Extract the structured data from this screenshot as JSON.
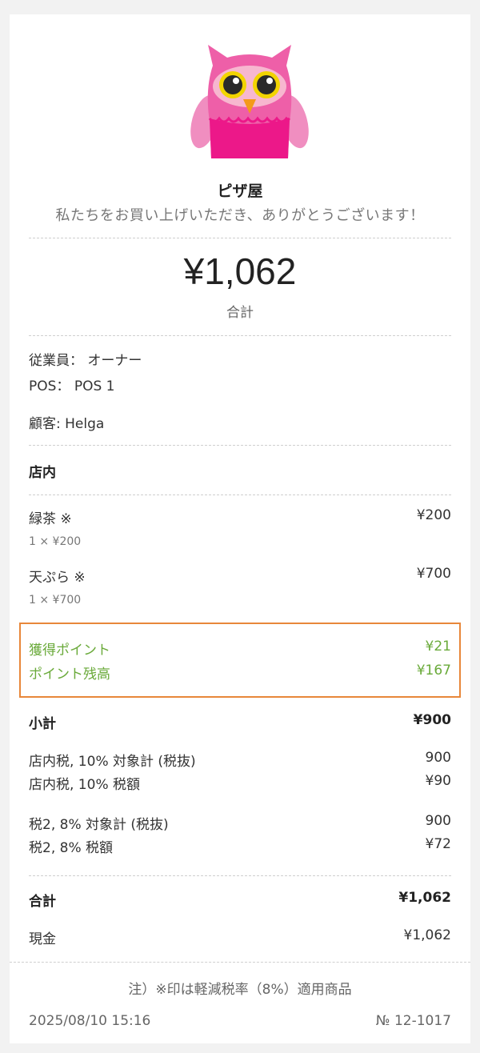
{
  "header": {
    "shop_name": "ピザ屋",
    "thanks": "私たちをお買い上げいただき、ありがとうございます！"
  },
  "summary": {
    "total": "¥1,062",
    "total_label": "合計"
  },
  "info": {
    "employee": "従業員：  オーナー",
    "pos": "POS：   POS 1",
    "customer": "顧客: Helga"
  },
  "dining_option": "店内",
  "items": [
    {
      "name": "緑茶 ※",
      "detail": "1 × ¥200",
      "price": "¥200"
    },
    {
      "name": "天ぷら ※",
      "detail": "1 × ¥700",
      "price": "¥700"
    }
  ],
  "points": {
    "earned_label": "獲得ポイント",
    "earned_value": "¥21",
    "balance_label": "ポイント残高",
    "balance_value": "¥167"
  },
  "subtotal": {
    "label": "小計",
    "value": "¥900"
  },
  "taxes": [
    {
      "label": "店内税, 10% 対象計 (税抜)",
      "value": "900"
    },
    {
      "label": "店内税, 10% 税額",
      "value": "¥90"
    },
    {
      "label": "税2, 8% 対象計 (税抜)",
      "value": "900"
    },
    {
      "label": "税2, 8% 税額",
      "value": "¥72"
    }
  ],
  "grand_total": {
    "label": "合計",
    "value": "¥1,062"
  },
  "payment": {
    "label": "現金",
    "value": "¥1,062"
  },
  "footer": {
    "note": "注）※印は軽減税率（8%）適用商品",
    "datetime": "2025/08/10 15:16",
    "receipt_no": "№ 12-1017"
  },
  "colors": {
    "points_green": "#6aaa3a",
    "highlight_border": "#e8873a",
    "owl_pink": "#ee5fa8",
    "owl_magenta": "#ec1889"
  }
}
